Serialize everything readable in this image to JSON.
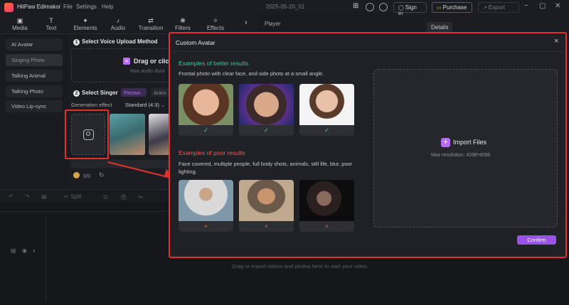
{
  "app": {
    "title": "HitPaw Edimakor",
    "project": "2025-05-20_01"
  },
  "menu": [
    "File",
    "Settings",
    "Help"
  ],
  "topbar": {
    "sign_in": "Sign in",
    "purchase": "Purchase",
    "export": "Export"
  },
  "toolbar": [
    {
      "label": "Media",
      "glyph": "▣"
    },
    {
      "label": "Text",
      "glyph": "T"
    },
    {
      "label": "Elements",
      "glyph": "✦"
    },
    {
      "label": "Audio",
      "glyph": "♪"
    },
    {
      "label": "Transition",
      "glyph": "⇄"
    },
    {
      "label": "Filters",
      "glyph": "❋"
    },
    {
      "label": "Effects",
      "glyph": "✧"
    }
  ],
  "leftnav": [
    "AI Avatar",
    "Singing Photo",
    "Talking Animal",
    "Talking Photo",
    "Video Lip-sync"
  ],
  "midpanel": {
    "step1": "Select Voice Upload Method",
    "drag": "Drag or clic",
    "drag_hint": "Max audio dura",
    "step2": "Select Singer",
    "tab_person": "Person",
    "tab_anime": "Anim",
    "gen_label": "Generation effect",
    "gen_value": "Standard (4:3)",
    "credits": "0/0"
  },
  "player": {
    "label": "Player"
  },
  "details": {
    "label": "Details"
  },
  "timeline": {
    "split": "Split",
    "drop_hint": "Drag or import videos and photos here to start your video."
  },
  "modal": {
    "title": "Custom Avatar",
    "good_heading": "Examples of better results",
    "good_desc": "Frontal photo with clear face, and side photo at a small angle.",
    "bad_heading": "Examples of poor results",
    "bad_desc": "Face covered, multiple people, full body shots, animals, still life, blur, poor lighting.",
    "import_label": "Import Files",
    "max_res": "Max resolution: 4096*4096",
    "confirm": "Confirm",
    "good_mark": "✓",
    "bad_mark": "×"
  },
  "colors": {
    "accent": "#9b52e8",
    "good": "#36c98e",
    "bad": "#ee5a56",
    "highlight": "#e53029"
  }
}
